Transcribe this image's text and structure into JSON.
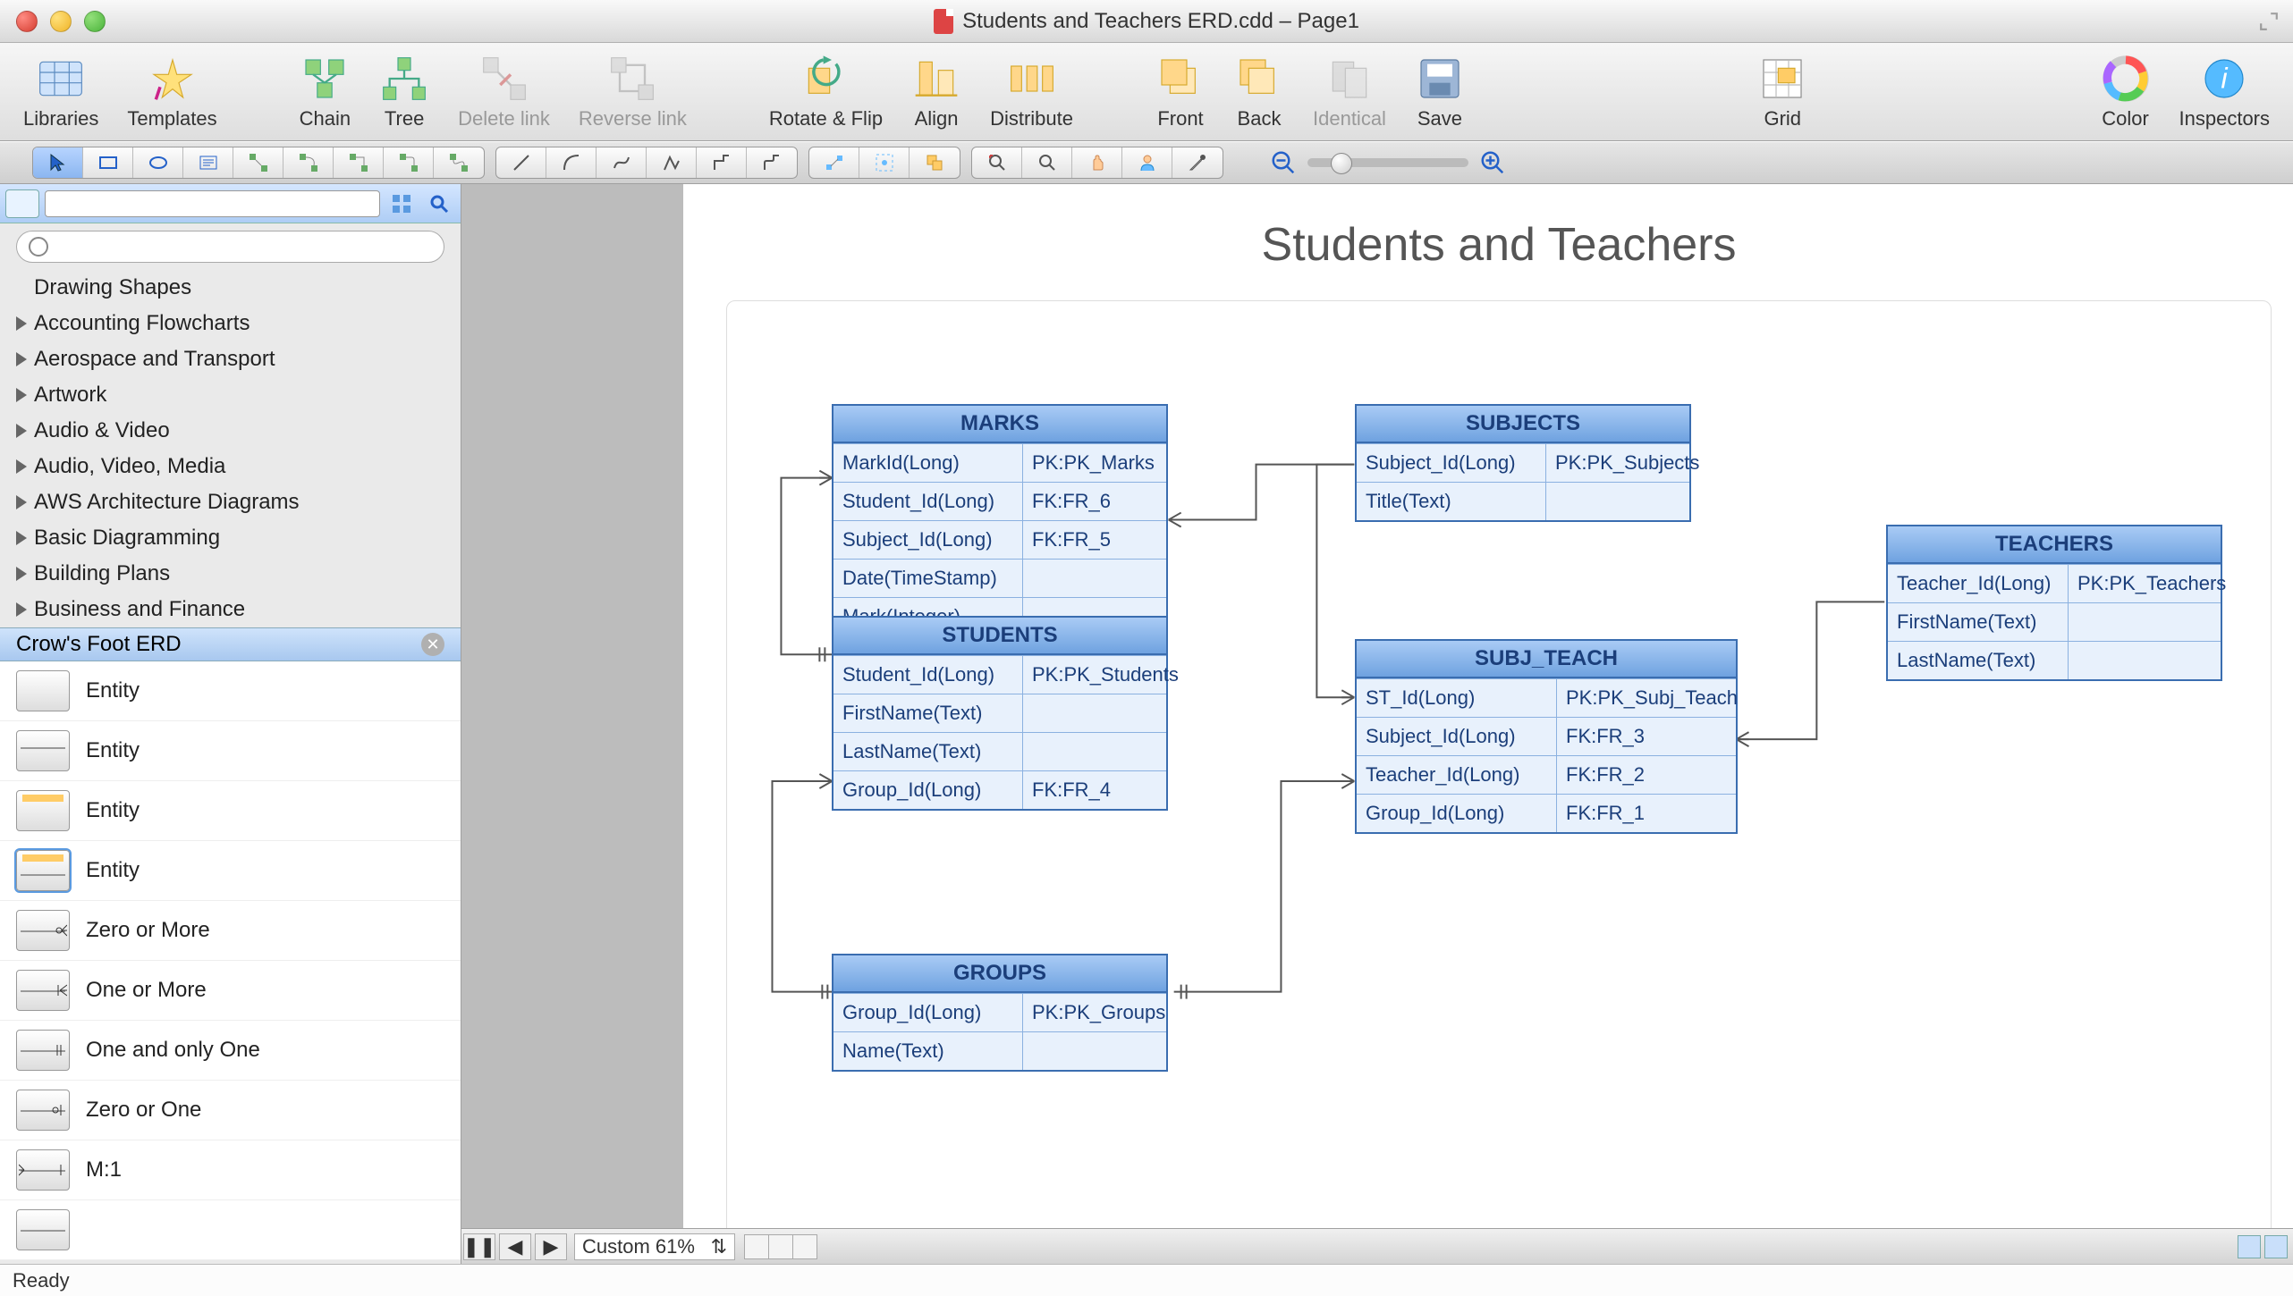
{
  "window": {
    "title": "Students and Teachers ERD.cdd – Page1"
  },
  "toolbar": {
    "libraries": "Libraries",
    "templates": "Templates",
    "chain": "Chain",
    "tree": "Tree",
    "delete_link": "Delete link",
    "reverse_link": "Reverse link",
    "rotate_flip": "Rotate & Flip",
    "align": "Align",
    "distribute": "Distribute",
    "front": "Front",
    "back": "Back",
    "identical": "Identical",
    "save": "Save",
    "grid": "Grid",
    "color": "Color",
    "inspectors": "Inspectors"
  },
  "sidebar": {
    "search_placeholder": "",
    "categories": [
      "Drawing Shapes",
      "Accounting Flowcharts",
      "Aerospace and Transport",
      "Artwork",
      "Audio & Video",
      "Audio, Video, Media",
      "AWS Architecture Diagrams",
      "Basic Diagramming",
      "Building Plans",
      "Business and Finance"
    ],
    "selected_library": "Crow's Foot ERD",
    "shapes": [
      {
        "label": "Entity"
      },
      {
        "label": "Entity"
      },
      {
        "label": "Entity"
      },
      {
        "label": "Entity"
      },
      {
        "label": "Zero or More"
      },
      {
        "label": "One or More"
      },
      {
        "label": "One and only One"
      },
      {
        "label": "Zero or One"
      },
      {
        "label": "M:1"
      }
    ]
  },
  "diagram": {
    "title": "Students and Teachers",
    "entities": {
      "marks": {
        "name": "MARKS",
        "rows": [
          [
            "MarkId(Long)",
            "PK:PK_Marks"
          ],
          [
            "Student_Id(Long)",
            "FK:FR_6"
          ],
          [
            "Subject_Id(Long)",
            "FK:FR_5"
          ],
          [
            "Date(TimeStamp)",
            ""
          ],
          [
            "Mark(Integer)",
            ""
          ]
        ]
      },
      "subjects": {
        "name": "SUBJECTS",
        "rows": [
          [
            "Subject_Id(Long)",
            "PK:PK_Subjects"
          ],
          [
            "Title(Text)",
            ""
          ]
        ]
      },
      "students": {
        "name": "STUDENTS",
        "rows": [
          [
            "Student_Id(Long)",
            "PK:PK_Students"
          ],
          [
            "FirstName(Text)",
            ""
          ],
          [
            "LastName(Text)",
            ""
          ],
          [
            "Group_Id(Long)",
            "FK:FR_4"
          ]
        ]
      },
      "subj_teach": {
        "name": "SUBJ_TEACH",
        "rows": [
          [
            "ST_Id(Long)",
            "PK:PK_Subj_Teach"
          ],
          [
            "Subject_Id(Long)",
            "FK:FR_3"
          ],
          [
            "Teacher_Id(Long)",
            "FK:FR_2"
          ],
          [
            "Group_Id(Long)",
            "FK:FR_1"
          ]
        ]
      },
      "teachers": {
        "name": "TEACHERS",
        "rows": [
          [
            "Teacher_Id(Long)",
            "PK:PK_Teachers"
          ],
          [
            "FirstName(Text)",
            ""
          ],
          [
            "LastName(Text)",
            ""
          ]
        ]
      },
      "groups": {
        "name": "GROUPS",
        "rows": [
          [
            "Group_Id(Long)",
            "PK:PK_Groups"
          ],
          [
            "Name(Text)",
            ""
          ]
        ]
      }
    }
  },
  "footer": {
    "zoom_label": "Custom 61%",
    "status": "Ready"
  }
}
